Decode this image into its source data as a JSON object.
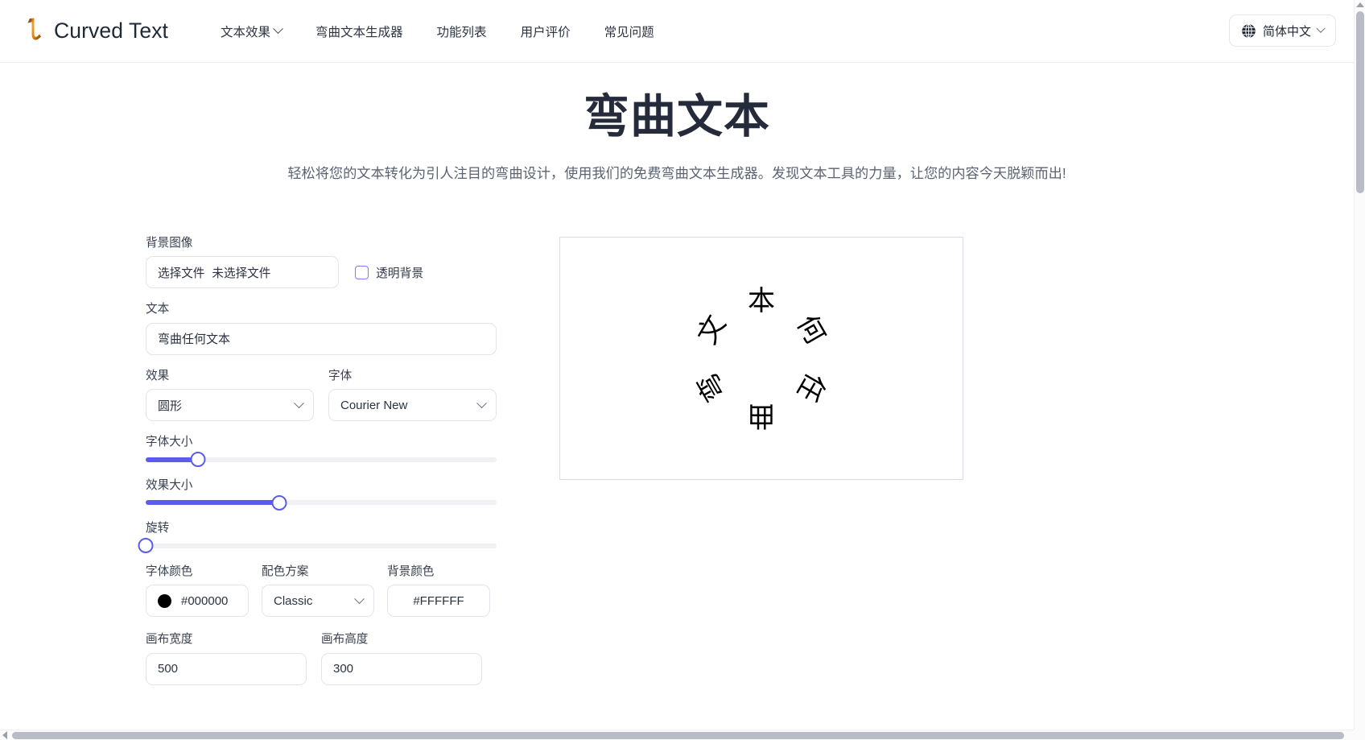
{
  "header": {
    "brand": "Curved Text",
    "logo_icon": "curved-l-logo",
    "nav": [
      {
        "label": "文本效果",
        "has_dropdown": true
      },
      {
        "label": "弯曲文本生成器",
        "has_dropdown": false
      },
      {
        "label": "功能列表",
        "has_dropdown": false
      },
      {
        "label": "用户评价",
        "has_dropdown": false
      },
      {
        "label": "常见问题",
        "has_dropdown": false
      }
    ],
    "language": {
      "label": "简体中文",
      "globe_icon": "globe-icon",
      "chevron_icon": "chevron-down-icon"
    }
  },
  "hero": {
    "title": "弯曲文本",
    "subtitle": "轻松将您的文本转化为引人注目的弯曲设计，使用我们的免费弯曲文本生成器。发现文本工具的力量，让您的内容今天脱颖而出!"
  },
  "form": {
    "background_image": {
      "label": "背景图像",
      "button_text": "选择文件",
      "status_text": "未选择文件"
    },
    "transparent_bg": {
      "label": "透明背景",
      "checked": false
    },
    "text": {
      "label": "文本",
      "value": "弯曲任何文本"
    },
    "effect": {
      "label": "效果",
      "value": "圆形"
    },
    "font": {
      "label": "字体",
      "value": "Courier New"
    },
    "font_size": {
      "label": "字体大小",
      "percent": 15
    },
    "effect_size": {
      "label": "效果大小",
      "percent": 38
    },
    "rotation": {
      "label": "旋转",
      "percent": 0
    },
    "font_color": {
      "label": "字体颜色",
      "value": "#000000"
    },
    "color_scheme": {
      "label": "配色方案",
      "value": "Classic"
    },
    "background_color": {
      "label": "背景颜色",
      "value": "#FFFFFF"
    },
    "canvas_width": {
      "label": "画布宽度",
      "value": "500"
    },
    "canvas_height": {
      "label": "画布高度",
      "value": "300"
    }
  },
  "preview": {
    "name": "curved-text-canvas",
    "chars": [
      "本",
      "何",
      "任",
      "曲",
      "弯",
      "文"
    ],
    "text_color": "#000000",
    "bg_color": "#FFFFFF"
  },
  "colors": {
    "accent": "#5B5BEC",
    "heading": "#252B3B",
    "body": "#5B6372",
    "border": "#E3E3EA"
  }
}
